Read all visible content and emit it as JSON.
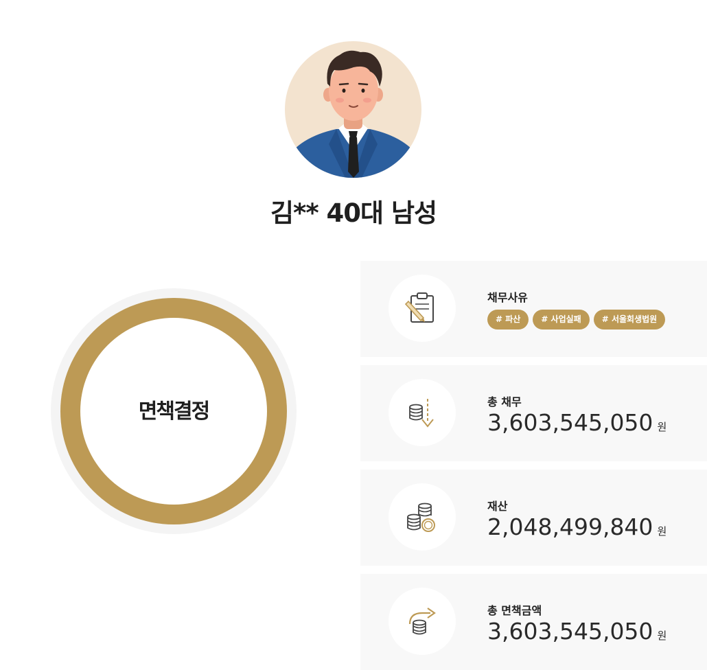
{
  "profile": {
    "name": "김** 40대 남성"
  },
  "result": {
    "label": "면책결정"
  },
  "cards": [
    {
      "title": "채무사유",
      "icon": "clipboard-pencil-icon",
      "tags": [
        "# 파산",
        "# 사업실패",
        "# 서울회생법원"
      ]
    },
    {
      "title": "총 채무",
      "icon": "coins-down-arrow-icon",
      "value": "3,603,545,050",
      "unit": "원"
    },
    {
      "title": "재산",
      "icon": "coin-stack-icon",
      "value": "2,048,499,840",
      "unit": "원"
    },
    {
      "title": "총 면책금액",
      "icon": "coins-transfer-arrow-icon",
      "value": "3,603,545,050",
      "unit": "원"
    }
  ],
  "colors": {
    "accent_gold": "#bd9a55",
    "card_bg": "#f8f8f8",
    "avatar_bg": "#f3e3cf"
  }
}
